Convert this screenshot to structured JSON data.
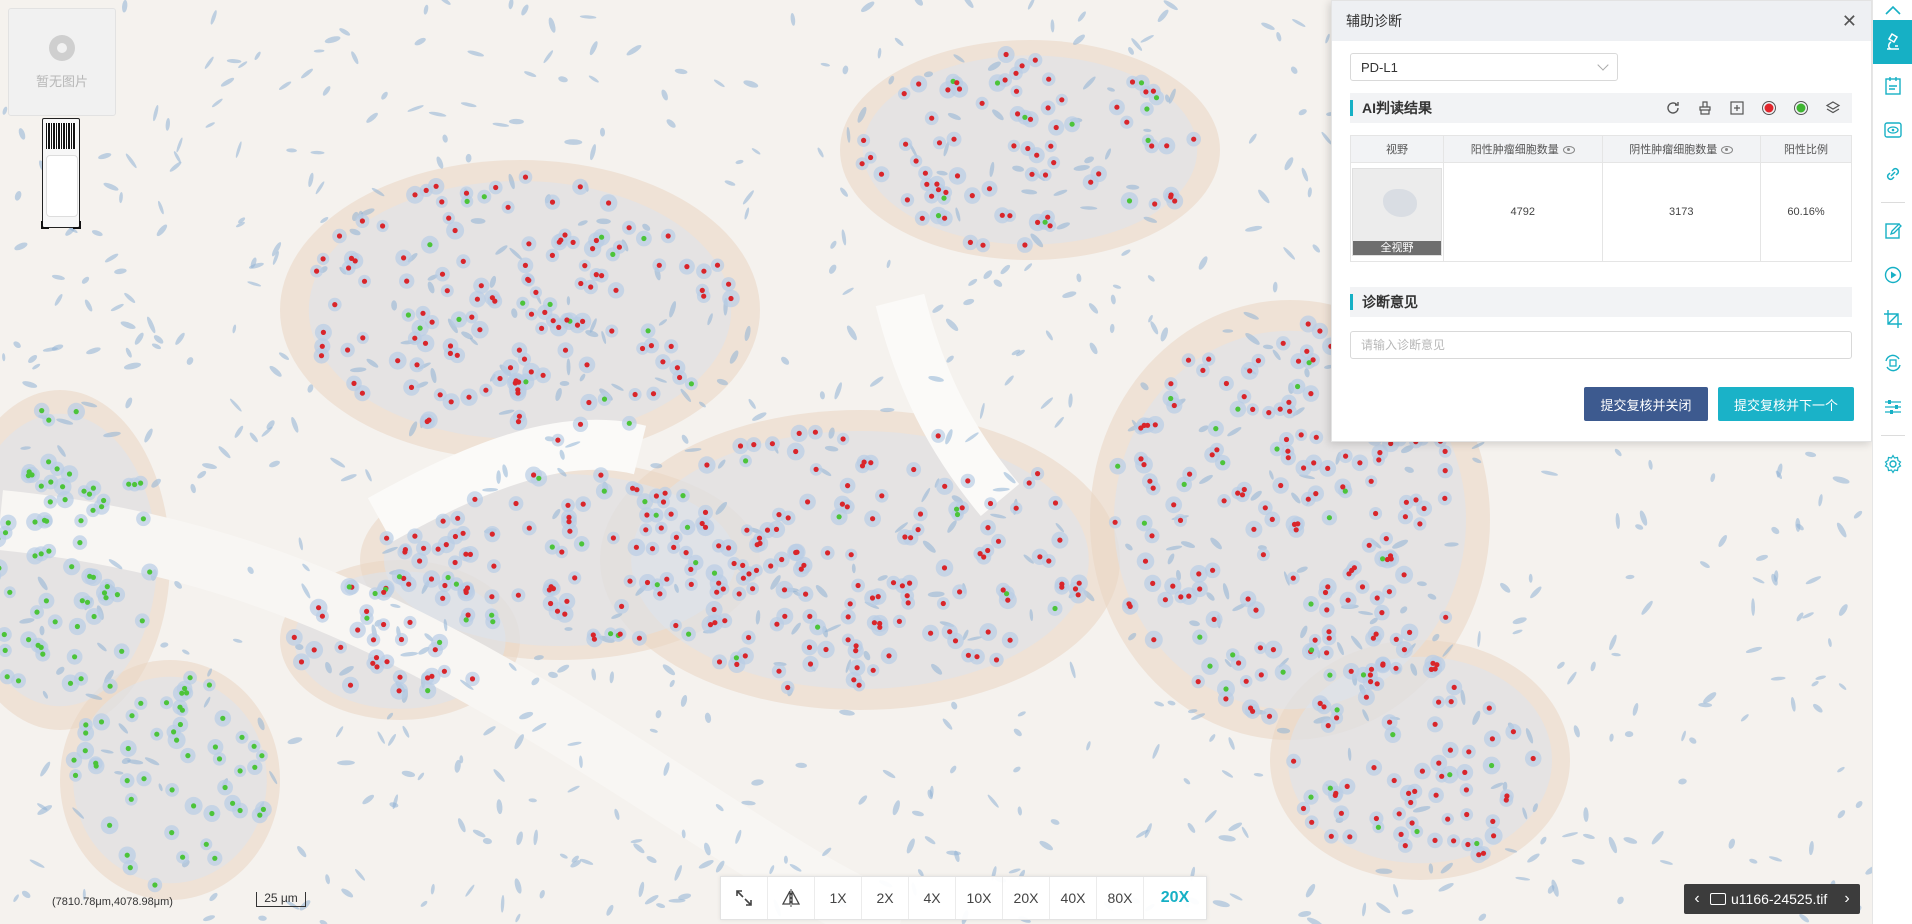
{
  "viewer": {
    "thumbnail_placeholder": "暂无图片",
    "coordinates": "(7810.78μm,4078.98μm)",
    "scale_label": "25 μm",
    "zoom_levels": [
      "1X",
      "2X",
      "4X",
      "10X",
      "20X",
      "40X",
      "80X"
    ],
    "current_zoom": "20X",
    "file_name": "u1166-24525.tif"
  },
  "panel": {
    "title": "辅助诊断",
    "close_icon": "close-icon",
    "stain_select": "PD-L1",
    "ai_section_title": "AI判读结果",
    "tool_icons": [
      "refresh-icon",
      "clear-icon",
      "add-region-icon",
      "positive-marker-icon",
      "negative-marker-icon",
      "layers-icon"
    ],
    "table": {
      "headers": [
        "视野",
        "阳性肿瘤细胞数量",
        "阴性肿瘤细胞数量",
        "阳性比例"
      ],
      "row": {
        "view_label": "全视野",
        "positive": "4792",
        "negative": "3173",
        "ratio": "60.16%"
      }
    },
    "opinion_section_title": "诊断意见",
    "opinion_placeholder": "请输入诊断意见",
    "submit_close": "提交复核并关闭",
    "submit_next": "提交复核并下一个"
  },
  "rail": {
    "icons": [
      "collapse-up-icon",
      "microscope-icon",
      "report-icon",
      "eye-icon",
      "link-icon",
      "edit-icon",
      "play-icon",
      "crop-icon",
      "rotate-icon",
      "sliders-icon",
      "settings-icon"
    ]
  },
  "colors": {
    "accent": "#16b0c5",
    "primary_button": "#3d5a8f",
    "positive_dot": "#d9252b",
    "negative_dot": "#4cc43a"
  }
}
